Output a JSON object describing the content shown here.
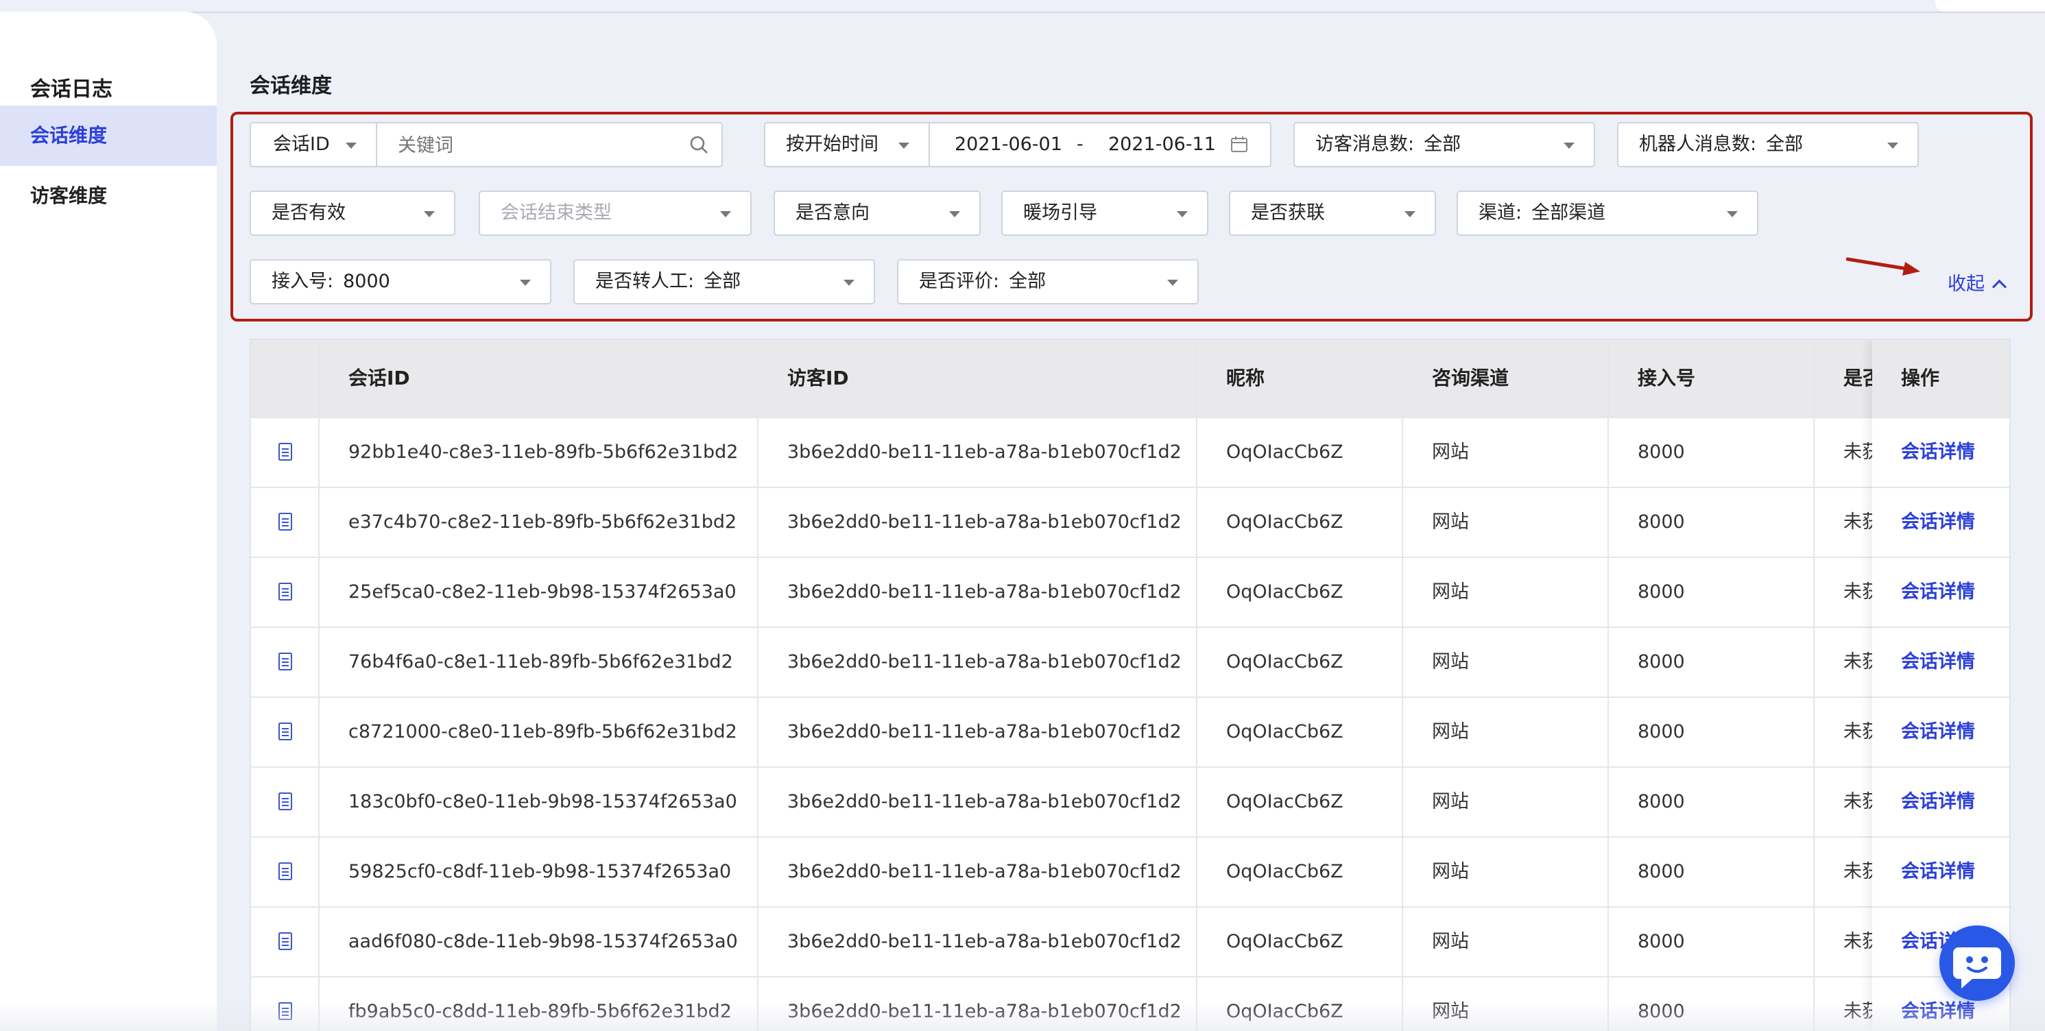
{
  "sidebar": {
    "title": "会话日志",
    "items": [
      {
        "label": "会话维度",
        "active": true
      },
      {
        "label": "访客维度",
        "active": false
      }
    ]
  },
  "page_title": "会话维度",
  "filters": {
    "search_type": "会话ID",
    "keyword_placeholder": "关键词",
    "time_mode": "按开始时间",
    "date_start": "2021-06-01",
    "date_sep": "-",
    "date_end": "2021-06-11",
    "visitor_msgs": {
      "label": "访客消息数:",
      "value": "全部"
    },
    "robot_msgs": {
      "label": "机器人消息数:",
      "value": "全部"
    },
    "is_valid": "是否有效",
    "end_type_placeholder": "会话结束类型",
    "is_intent": "是否意向",
    "warmup": "暖场引导",
    "is_acquired": "是否获联",
    "channel": {
      "label": "渠道:",
      "value": "全部渠道"
    },
    "access_no": {
      "label": "接入号:",
      "value": "8000"
    },
    "to_human": {
      "label": "是否转人工:",
      "value": "全部"
    },
    "is_rated": {
      "label": "是否评价:",
      "value": "全部"
    },
    "collapse_label": "收起"
  },
  "table": {
    "headers": [
      "会话ID",
      "访客ID",
      "昵称",
      "咨询渠道",
      "接入号",
      "是否",
      "操作"
    ],
    "rows": [
      {
        "session_id": "92bb1e40-c8e3-11eb-89fb-5b6f62e31bd2",
        "visitor_id": "3b6e2dd0-be11-11eb-a78a-b1eb070cf1d2",
        "nickname": "OqOIacCb6Z",
        "channel": "网站",
        "access": "8000",
        "flag": "未获",
        "action": "会话详情"
      },
      {
        "session_id": "e37c4b70-c8e2-11eb-89fb-5b6f62e31bd2",
        "visitor_id": "3b6e2dd0-be11-11eb-a78a-b1eb070cf1d2",
        "nickname": "OqOIacCb6Z",
        "channel": "网站",
        "access": "8000",
        "flag": "未获",
        "action": "会话详情"
      },
      {
        "session_id": "25ef5ca0-c8e2-11eb-9b98-15374f2653a0",
        "visitor_id": "3b6e2dd0-be11-11eb-a78a-b1eb070cf1d2",
        "nickname": "OqOIacCb6Z",
        "channel": "网站",
        "access": "8000",
        "flag": "未获",
        "action": "会话详情"
      },
      {
        "session_id": "76b4f6a0-c8e1-11eb-89fb-5b6f62e31bd2",
        "visitor_id": "3b6e2dd0-be11-11eb-a78a-b1eb070cf1d2",
        "nickname": "OqOIacCb6Z",
        "channel": "网站",
        "access": "8000",
        "flag": "未获",
        "action": "会话详情"
      },
      {
        "session_id": "c8721000-c8e0-11eb-89fb-5b6f62e31bd2",
        "visitor_id": "3b6e2dd0-be11-11eb-a78a-b1eb070cf1d2",
        "nickname": "OqOIacCb6Z",
        "channel": "网站",
        "access": "8000",
        "flag": "未获",
        "action": "会话详情"
      },
      {
        "session_id": "183c0bf0-c8e0-11eb-9b98-15374f2653a0",
        "visitor_id": "3b6e2dd0-be11-11eb-a78a-b1eb070cf1d2",
        "nickname": "OqOIacCb6Z",
        "channel": "网站",
        "access": "8000",
        "flag": "未获",
        "action": "会话详情"
      },
      {
        "session_id": "59825cf0-c8df-11eb-9b98-15374f2653a0",
        "visitor_id": "3b6e2dd0-be11-11eb-a78a-b1eb070cf1d2",
        "nickname": "OqOIacCb6Z",
        "channel": "网站",
        "access": "8000",
        "flag": "未获",
        "action": "会话详情"
      },
      {
        "session_id": "aad6f080-c8de-11eb-9b98-15374f2653a0",
        "visitor_id": "3b6e2dd0-be11-11eb-a78a-b1eb070cf1d2",
        "nickname": "OqOIacCb6Z",
        "channel": "网站",
        "access": "8000",
        "flag": "未获",
        "action": "会话详"
      },
      {
        "session_id": "fb9ab5c0-c8dd-11eb-89fb-5b6f62e31bd2",
        "visitor_id": "3b6e2dd0-be11-11eb-a78a-b1eb070cf1d2",
        "nickname": "OqOIacCb6Z",
        "channel": "网站",
        "access": "8000",
        "flag": "未获",
        "action": "会话详情"
      }
    ]
  },
  "colors": {
    "accent": "#2b3fd9",
    "highlight_border": "#b21d12",
    "fab": "#2a58e6"
  },
  "icons": [
    "search-icon",
    "calendar-icon",
    "document-icon",
    "chevron-up-icon",
    "chat-bot-icon",
    "caret-down-icon"
  ]
}
